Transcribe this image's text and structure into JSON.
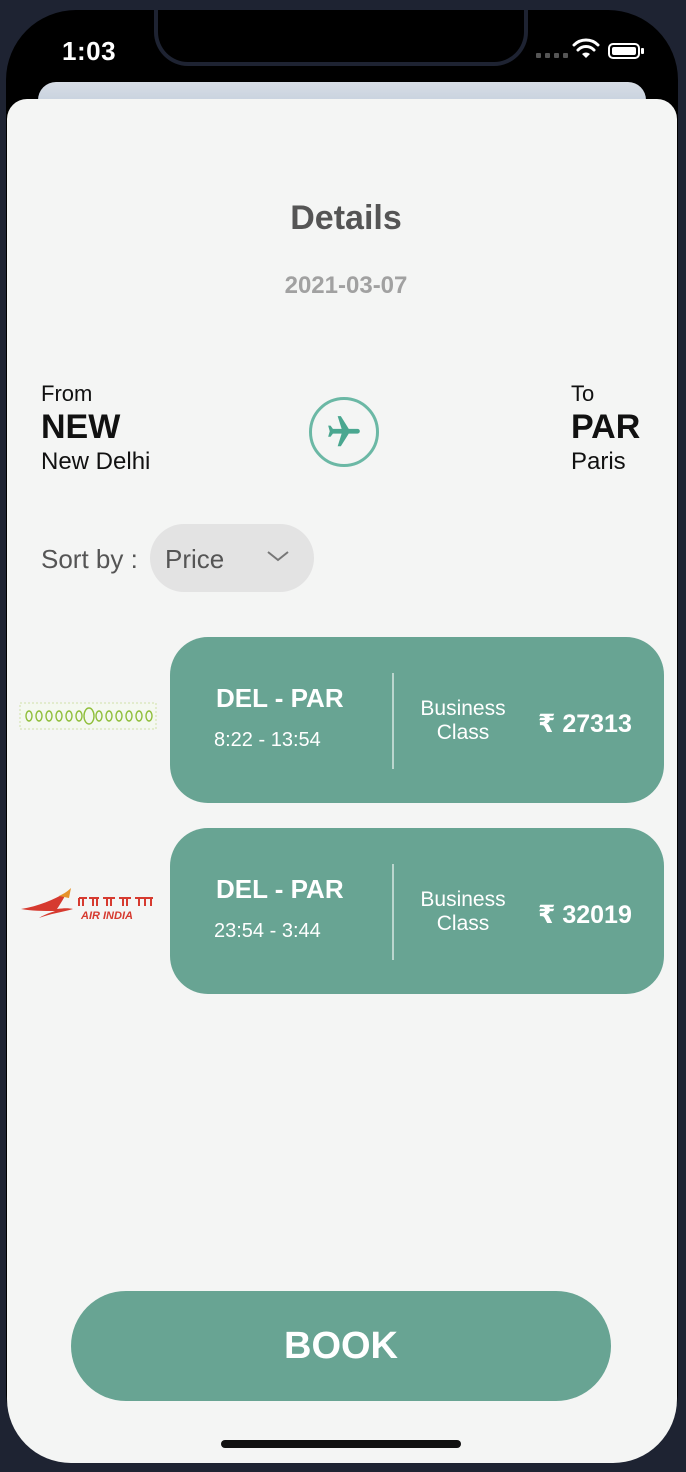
{
  "status_bar": {
    "time": "1:03"
  },
  "header": {
    "title": "Details",
    "date": "2021-03-07"
  },
  "route": {
    "from": {
      "label": "From",
      "code": "NEW",
      "city": "New Delhi"
    },
    "to": {
      "label": "To",
      "code": "PAR",
      "city": "Paris"
    }
  },
  "sort": {
    "label": "Sort by :",
    "selected": "Price"
  },
  "flights": [
    {
      "airline_logo": "generic-airline-logo",
      "route": "DEL - PAR",
      "times": "8:22 - 13:54",
      "cabin_line1": "Business",
      "cabin_line2": "Class",
      "price": "₹ 27313"
    },
    {
      "airline_logo": "air-india-logo",
      "logo_text": "AIR INDIA",
      "route": "DEL - PAR",
      "times": "23:54 - 3:44",
      "cabin_line1": "Business",
      "cabin_line2": "Class",
      "price": "₹ 32019"
    }
  ],
  "actions": {
    "book_label": "BOOK"
  },
  "colors": {
    "accent": "#68a493",
    "sheet_background": "#f4f5f4",
    "sort_background": "#e3e3e3"
  },
  "icons": {
    "plane": "airplane-icon",
    "chevron": "chevron-down-icon",
    "wifi": "wifi-icon",
    "battery": "battery-icon"
  }
}
